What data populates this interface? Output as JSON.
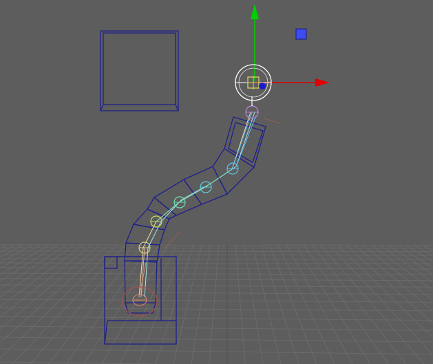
{
  "viewport": {
    "panel": "perspective-viewport",
    "background_color": "#5d5d5d",
    "grid_color": "#6b6b6b",
    "wireframe_color": "#1e1e8c",
    "selection_color": "#ffffff"
  },
  "manipulator": {
    "type": "move-tool",
    "x_axis_color": "#e00000",
    "y_axis_color": "#00d000",
    "z_axis_color": "#0000cc",
    "center_handle_color": "#d8d060",
    "plane_handle_color": "#4455ee"
  },
  "joint_chain": {
    "joint_count": 7,
    "colors": [
      "#e08870",
      "#e0d070",
      "#c0e060",
      "#70e0b0",
      "#60d0d8",
      "#60c0e8",
      "#b080d0"
    ]
  },
  "icons": {
    "move_tool": "move-manipulator-icon",
    "joint": "joint-icon",
    "ik_handle": "ik-handle-icon",
    "control_curve": "control-curve-icon"
  }
}
